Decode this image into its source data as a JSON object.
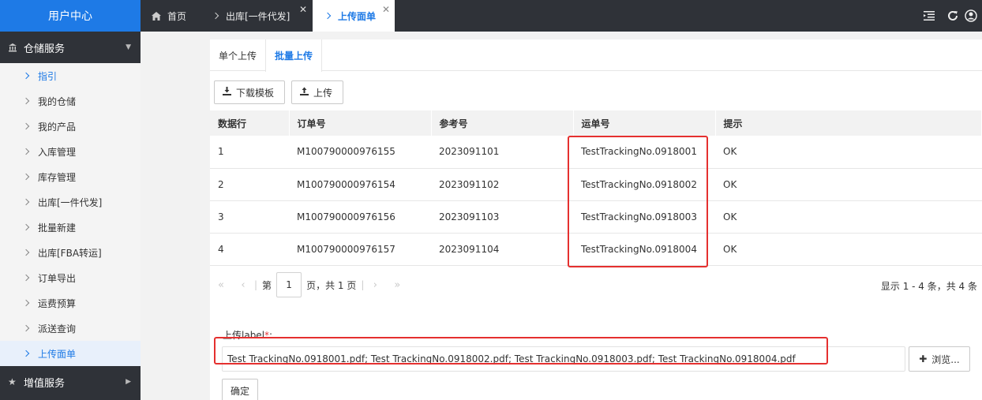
{
  "sidebar": {
    "brand": "用户中心",
    "groups": [
      {
        "label": "仓储服务"
      },
      {
        "label": "增值服务"
      }
    ],
    "items": [
      {
        "label": "指引"
      },
      {
        "label": "我的仓储"
      },
      {
        "label": "我的产品"
      },
      {
        "label": "入库管理"
      },
      {
        "label": "库存管理"
      },
      {
        "label": "出库[一件代发]"
      },
      {
        "label": "批量新建"
      },
      {
        "label": "出库[FBA转运]"
      },
      {
        "label": "订单导出"
      },
      {
        "label": "运费预算"
      },
      {
        "label": "派送查询"
      },
      {
        "label": "上传面单"
      }
    ]
  },
  "tabs": [
    {
      "label": "首页"
    },
    {
      "label": "出库[一件代发]"
    },
    {
      "label": "上传面单"
    }
  ],
  "subtabs": [
    {
      "label": "单个上传"
    },
    {
      "label": "批量上传"
    }
  ],
  "toolbar": {
    "download_label": "下载模板",
    "upload_label": "上传"
  },
  "table": {
    "columns": [
      "数据行",
      "订单号",
      "参考号",
      "运单号",
      "提示"
    ],
    "rows": [
      [
        "1",
        "M100790000976155",
        "2023091101",
        "TestTrackingNo.0918001",
        "OK"
      ],
      [
        "2",
        "M100790000976154",
        "2023091102",
        "TestTrackingNo.0918002",
        "OK"
      ],
      [
        "3",
        "M100790000976156",
        "2023091103",
        "TestTrackingNo.0918003",
        "OK"
      ],
      [
        "4",
        "M100790000976157",
        "2023091104",
        "TestTrackingNo.0918004",
        "OK"
      ]
    ]
  },
  "pager": {
    "prefix": "第",
    "page": "1",
    "suffix": "页，共 1 页",
    "info": "显示 1 - 4 条，共 4 条"
  },
  "form": {
    "label": "上传label",
    "required_mark": "*",
    "colon": ":",
    "file_value": "Test TrackingNo.0918001.pdf; Test TrackingNo.0918002.pdf; Test TrackingNo.0918003.pdf; Test TrackingNo.0918004.pdf",
    "browse_label": "浏览...",
    "confirm_label": "确定"
  },
  "colors": {
    "brand_blue": "#1e7ae6",
    "sidebar_dark": "#2f3238",
    "highlight_red": "#e5302f"
  }
}
